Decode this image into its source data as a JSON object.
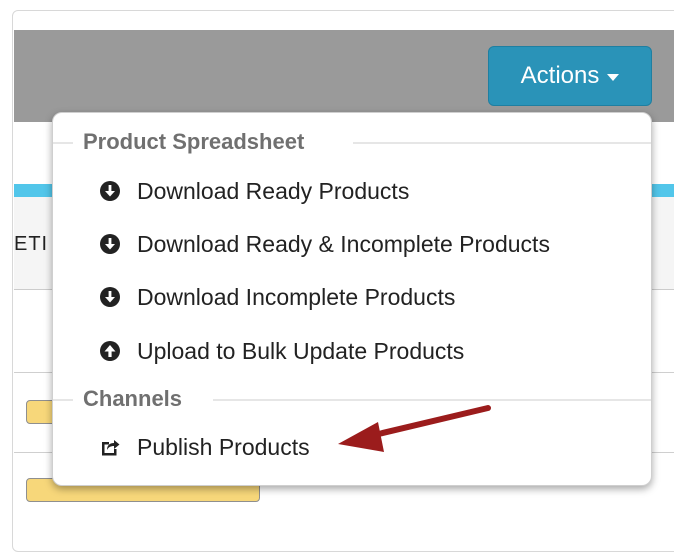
{
  "toolbar": {
    "actions_label": "Actions"
  },
  "table": {
    "header_fragment": "ETI"
  },
  "menu": {
    "sections": [
      {
        "title": "Product Spreadsheet",
        "items": [
          {
            "label": "Download Ready Products",
            "icon": "download-circle-icon"
          },
          {
            "label": "Download Ready & Incomplete Products",
            "icon": "download-circle-icon"
          },
          {
            "label": "Download Incomplete Products",
            "icon": "download-circle-icon"
          },
          {
            "label": "Upload to Bulk Update Products",
            "icon": "upload-circle-icon"
          }
        ]
      },
      {
        "title": "Channels",
        "items": [
          {
            "label": "Publish Products",
            "icon": "share-icon"
          }
        ]
      }
    ]
  },
  "colors": {
    "actions_button": "#2a93b8",
    "toolbar_band": "#9a9a9a",
    "accent_bar": "#52c6ea",
    "tag_fill": "#f7d77a",
    "annotation_arrow": "#9b1c1c"
  }
}
